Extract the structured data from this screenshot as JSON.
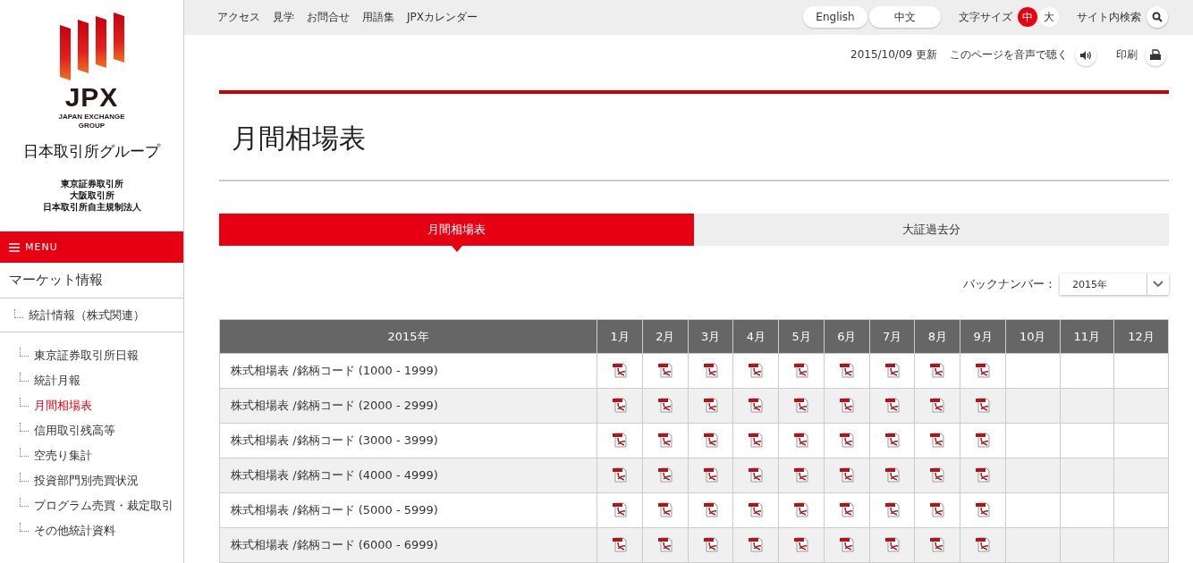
{
  "sidebar": {
    "logo": {
      "wordmark": "JPX",
      "tagline": "JAPAN EXCHANGE GROUP"
    },
    "group_name": "日本取引所グループ",
    "companies": [
      "東京証券取引所",
      "大阪取引所",
      "日本取引所自主規制法人"
    ],
    "menu_label": "MENU",
    "section": "マーケット情報",
    "tree": [
      {
        "label": "統計情報（株式関連）",
        "selected": false,
        "children": [
          {
            "label": "東京証券取引所日報",
            "selected": false
          },
          {
            "label": "統計月報",
            "selected": false
          },
          {
            "label": "月間相場表",
            "selected": true
          },
          {
            "label": "信用取引残高等",
            "selected": false
          },
          {
            "label": "空売り集計",
            "selected": false
          },
          {
            "label": "投資部門別売買状況",
            "selected": false
          },
          {
            "label": "プログラム売買・裁定取引",
            "selected": false
          },
          {
            "label": "その他統計資料",
            "selected": false
          }
        ]
      }
    ]
  },
  "top_nav": {
    "links": [
      "アクセス",
      "見学",
      "お問合せ",
      "用語集",
      "JPXカレンダー"
    ],
    "languages": [
      "English",
      "中文"
    ],
    "font_size_label": "文字サイズ",
    "font_sizes": [
      {
        "label": "中",
        "selected": true
      },
      {
        "label": "大",
        "selected": false
      }
    ],
    "search_label": "サイト内検索"
  },
  "utility": {
    "updated": "2015/10/09 更新",
    "listen": "このページを音声で聴く",
    "print": "印刷"
  },
  "page_title": "月間相場表",
  "tabs": [
    {
      "label": "月間相場表",
      "selected": true
    },
    {
      "label": "大証過去分",
      "selected": false
    }
  ],
  "back_number": {
    "label": "バックナンバー：",
    "value": "2015年"
  },
  "table": {
    "columns": [
      "2015年",
      "1月",
      "2月",
      "3月",
      "4月",
      "5月",
      "6月",
      "7月",
      "8月",
      "9月",
      "10月",
      "11月",
      "12月"
    ],
    "rows": [
      {
        "label": "株式相場表 /銘柄コード (1000 - 1999)",
        "files": [
          true,
          true,
          true,
          true,
          true,
          true,
          true,
          true,
          true,
          false,
          false,
          false
        ]
      },
      {
        "label": "株式相場表 /銘柄コード (2000 - 2999)",
        "files": [
          true,
          true,
          true,
          true,
          true,
          true,
          true,
          true,
          true,
          false,
          false,
          false
        ]
      },
      {
        "label": "株式相場表 /銘柄コード (3000 - 3999)",
        "files": [
          true,
          true,
          true,
          true,
          true,
          true,
          true,
          true,
          true,
          false,
          false,
          false
        ]
      },
      {
        "label": "株式相場表 /銘柄コード (4000 - 4999)",
        "files": [
          true,
          true,
          true,
          true,
          true,
          true,
          true,
          true,
          true,
          false,
          false,
          false
        ]
      },
      {
        "label": "株式相場表 /銘柄コード (5000 - 5999)",
        "files": [
          true,
          true,
          true,
          true,
          true,
          true,
          true,
          true,
          true,
          false,
          false,
          false
        ]
      },
      {
        "label": "株式相場表 /銘柄コード (6000 - 6999)",
        "files": [
          true,
          true,
          true,
          true,
          true,
          true,
          true,
          true,
          true,
          false,
          false,
          false
        ]
      }
    ]
  }
}
